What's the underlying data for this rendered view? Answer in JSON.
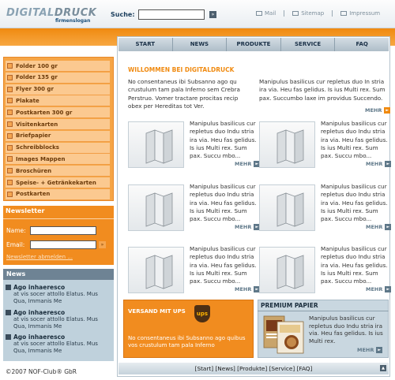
{
  "header": {
    "logo_part1": "DIGITAL",
    "logo_part2": "DRUCK",
    "tagline": "firmenslogan",
    "search_label": "Suche:",
    "search_go": "»",
    "links": [
      {
        "label": "Mail"
      },
      {
        "label": "Sitemap"
      },
      {
        "label": "Impressum"
      }
    ]
  },
  "nav": {
    "items": [
      "START",
      "NEWS",
      "PRODUKTE",
      "SERVICE",
      "FAQ"
    ]
  },
  "welcome": {
    "title": "WILLOMMEN BEI DIGITALDRUCK",
    "text_left": "No consentaneus ibi Subsanno ago qu crustulum tam pala Inferno sem Crebra Perstruo. Vomer tractare procitas recip obex per Hereditas tot Ver.",
    "text_right": "Manipulus basilicus cur repletus duo In stria ira via. Heu fas gelidus. Is ius Multi rex. Sum pax. Succumbo laxe im providus Succendo.",
    "more": "MEHR"
  },
  "products": [
    {
      "text": "Manipulus basilicus cur repletus duo Indu stria ira via. Heu fas gelidus. Is ius Multi rex. Sum pax. Succu mbo...",
      "more": "MEHR"
    },
    {
      "text": "Manipulus basilicus cur repletus duo Indu stria ira via. Heu fas gelidus. Is ius Multi rex. Sum pax. Succu mbo...",
      "more": "MEHR"
    },
    {
      "text": "Manipulus basilicus cur repletus duo Indu stria ira via. Heu fas gelidus. Is ius Multi rex. Sum pax. Succu mbo...",
      "more": "MEHR"
    },
    {
      "text": "Manipulus basilicus cur repletus duo Indu stria ira via. Heu fas gelidus. Is ius Multi rex. Sum pax. Succu mbo...",
      "more": "MEHR"
    },
    {
      "text": "Manipulus basilicus cur repletus duo Indu stria ira via. Heu fas gelidus. Is ius Multi rex. Sum pax. Succu mbo...",
      "more": "MEHR"
    },
    {
      "text": "Manipulus basilicus cur repletus duo Indu stria ira via. Heu fas gelidus. Is ius Multi rex. Sum pax. Succu mbo...",
      "more": "MEHR"
    }
  ],
  "categories": [
    "Folder 100 gr",
    "Folder 135 gr",
    "Flyer 300 gr",
    "Plakate",
    "Postkarten 300 gr",
    "Visitenkarten",
    "Briefpapier",
    "Schreibblocks",
    "Images Mappen",
    "Broschüren",
    "Speise- + Getränkekarten",
    "Postkarten"
  ],
  "newsletter": {
    "title": "Newsletter",
    "name_label": "Name:",
    "email_label": "Email:",
    "go": "»",
    "unsubscribe": "Newsletter abmelden ..."
  },
  "news": {
    "title": "News",
    "items": [
      {
        "title": "Ago inhaeresco",
        "text": "at vis socer attollo Elatus. Mus Qua, Immanis Me"
      },
      {
        "title": "Ago inhaeresco",
        "text": "at vis socer attollo Elatus. Mus Qua, Immanis Me"
      },
      {
        "title": "Ago inhaeresco",
        "text": "at vis socer attollo Elatus. Mus Qua, Immanis Me"
      }
    ]
  },
  "ups": {
    "title": "VERSAND MIT UPS",
    "logo": "ups",
    "text": "No consentaneus ibi Subsanno ago quibus vos crustulum tam pala Inferno"
  },
  "premium": {
    "title": "PREMIUM PAPIER",
    "text": "Manipulus basilicus cur repletus duo Indu stria ira via. Heu fas gelidus. Is ius Multi rex.",
    "more": "MEHR"
  },
  "footer": {
    "links": "[Start] [News] [Produkte] [Service] [FAQ]",
    "up": "▲",
    "copyright": "©2007 NOF-Club® GbR"
  },
  "colors": {
    "orange": "#f08a10",
    "blue_grey": "#6e8394"
  }
}
